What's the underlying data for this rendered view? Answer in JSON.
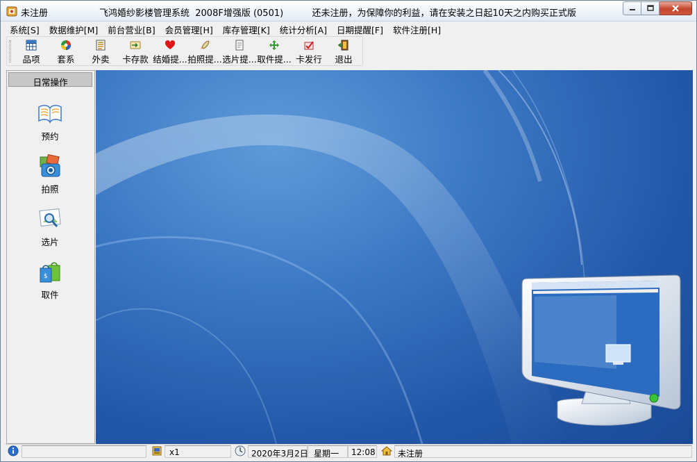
{
  "window": {
    "title_left": "未注册",
    "title_main": "飞鸿婚纱影楼管理系统  2008F增强版 (0501)          还未注册，为保障你的利益，请在安装之日起10天之内购买正式版"
  },
  "menu": [
    {
      "label": "系统[S]"
    },
    {
      "label": "数据维护[M]"
    },
    {
      "label": "前台营业[B]"
    },
    {
      "label": "会员管理[H]"
    },
    {
      "label": "库存管理[K]"
    },
    {
      "label": "统计分析[A]"
    },
    {
      "label": "日期提醒[F]"
    },
    {
      "label": "软件注册[H]"
    }
  ],
  "toolbar": [
    {
      "label": "品项",
      "icon": "grid-icon"
    },
    {
      "label": "套系",
      "icon": "color-wheel-icon"
    },
    {
      "label": "外卖",
      "icon": "list-icon"
    },
    {
      "label": "卡存款",
      "icon": "card-deposit-icon"
    },
    {
      "label": "结婚提...",
      "icon": "heart-icon"
    },
    {
      "label": "拍照提...",
      "icon": "rocket-icon"
    },
    {
      "label": "选片提...",
      "icon": "document-icon"
    },
    {
      "label": "取件提...",
      "icon": "move-icon"
    },
    {
      "label": "卡发行",
      "icon": "card-issue-icon"
    },
    {
      "label": "退出",
      "icon": "exit-door-icon"
    }
  ],
  "left_panel": {
    "header": "日常操作",
    "items": [
      {
        "label": "预约",
        "icon": "book-icon"
      },
      {
        "label": "拍照",
        "icon": "camera-icon"
      },
      {
        "label": "选片",
        "icon": "magnifier-photo-icon"
      },
      {
        "label": "取件",
        "icon": "shopping-bag-icon"
      }
    ]
  },
  "statusbar": {
    "count": "x1",
    "date": "2020年3月2日",
    "weekday": "星期一",
    "time": "12:08",
    "registration": "未注册"
  }
}
